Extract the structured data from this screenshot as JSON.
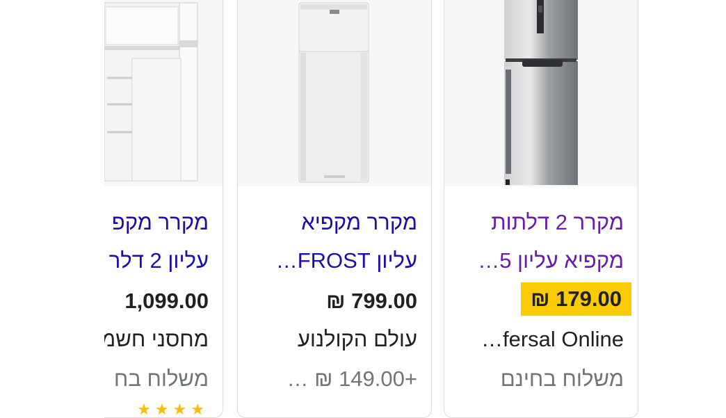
{
  "products": [
    {
      "title_line1": "מקרר 2 דלתות",
      "title_line2": "מקפיא עליון 5…",
      "price": "179.00 ₪",
      "merchant": "fersal Online…",
      "shipping": "משלוח בחינם",
      "highlighted": true,
      "image": "silver-fridge-image"
    },
    {
      "title_line1": "מקרר מקפיא",
      "title_line2": "עליון FROST…",
      "price": "799.00 ₪",
      "merchant": "עולם הקולנוע",
      "shipping": "+149.00 ₪ …",
      "highlighted": false,
      "image": "white-fridge-image"
    },
    {
      "title_line1": "מקרר מקפ",
      "title_line2": "עליון 2 דלר",
      "price": "1,099.00",
      "merchant": "מחסני חשמ",
      "shipping": "משלוח בח",
      "highlighted": false,
      "image": "open-fridge-image"
    }
  ],
  "colors": {
    "link": "#1a0dab",
    "visited_link": "#681da8",
    "price_highlight": "#fbcb06",
    "secondary_text": "#70757a"
  }
}
